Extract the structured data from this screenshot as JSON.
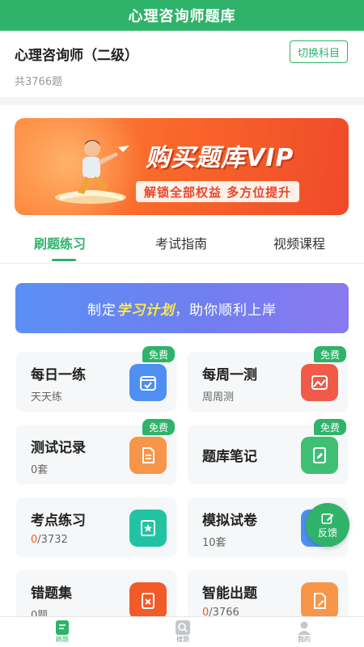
{
  "header": {
    "title": "心理咨询师题库"
  },
  "subject": {
    "title": "心理咨询师（二级）",
    "count": "共3766题",
    "switch_label": "切换科目"
  },
  "banner": {
    "title": "购买题库VIP",
    "subtitle": "解锁全部权益 多方位提升"
  },
  "tabs": [
    {
      "label": "刷题练习",
      "active": true
    },
    {
      "label": "考试指南",
      "active": false
    },
    {
      "label": "视频课程",
      "active": false
    }
  ],
  "plan": {
    "prefix": "制定",
    "highlight": "学习计划",
    "suffix": "，助你顺利上岸"
  },
  "cards": {
    "daily": {
      "title": "每日一练",
      "sub": "天天练",
      "badge": "免费",
      "icon": "calendar-check-icon",
      "color": "#4f8ff2"
    },
    "weekly": {
      "title": "每周一测",
      "sub": "周周测",
      "badge": "免费",
      "icon": "image-chart-icon",
      "color": "#f25a48"
    },
    "record": {
      "title": "测试记录",
      "sub": "0套",
      "badge": "免费",
      "icon": "document-icon",
      "color": "#f6964a"
    },
    "notes": {
      "title": "题库笔记",
      "badge": "免费",
      "icon": "notebook-edit-icon",
      "color": "#3fbf73"
    },
    "points": {
      "title": "考点练习",
      "sub_hit": "0",
      "sub_total": "/3732",
      "icon": "star-card-icon",
      "color": "#22c3a3"
    },
    "mock": {
      "title": "模拟试卷",
      "sub": "10套",
      "icon": "exam-paper-icon",
      "color": "#4f8ff2"
    },
    "wrong": {
      "title": "错题集",
      "sub": "0题",
      "icon": "wrong-doc-icon",
      "color": "#f25a2a"
    },
    "smart": {
      "title": "智能出题",
      "sub_hit": "0",
      "sub_total": "/3766",
      "icon": "smart-doc-icon",
      "color": "#f6964a"
    }
  },
  "feedback": {
    "label": "反馈",
    "icon": "edit-square-icon"
  },
  "tabbar": [
    {
      "label": "刷题",
      "icon": "practice-icon",
      "active": true
    },
    {
      "label": "搜题",
      "icon": "search-icon",
      "active": false
    },
    {
      "label": "我的",
      "icon": "user-icon",
      "active": false
    }
  ]
}
